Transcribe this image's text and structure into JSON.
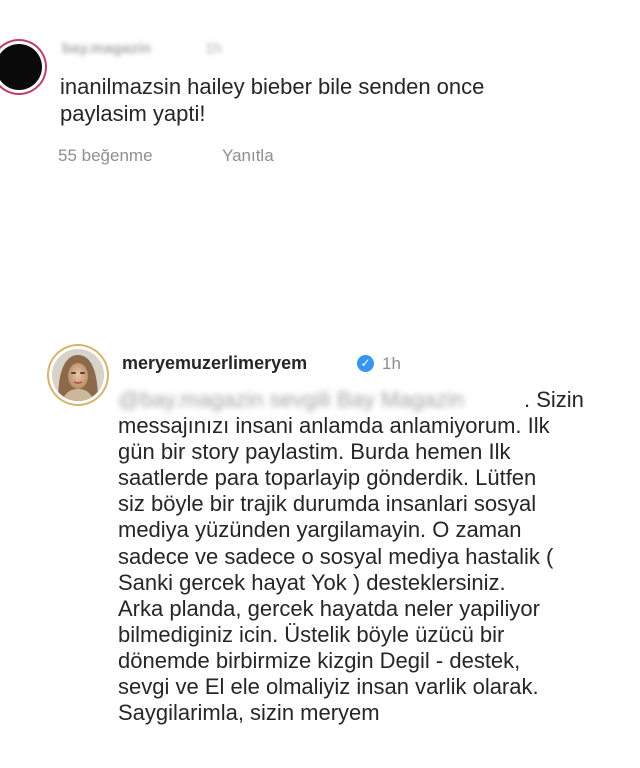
{
  "comments": [
    {
      "username": "bay.magazin",
      "time": "1h",
      "text": "inanilmazsin hailey bieber bile senden once\npaylasim yapti!",
      "likes": "55 beğenme",
      "reply": "Yanıtla"
    },
    {
      "username": "meryemuzerlimeryem",
      "verified": true,
      "time": "1h",
      "mention": "@bay.magazin sevgili Bay Magazin",
      "text_first": ". Sizin",
      "text": "messajınızı insani anlamda anlamiyorum. Ilk\ngün bir story paylastim. Burda hemen Ilk\nsaatlerde para toparlayip gönderdik. Lütfen\nsiz böyle bir trajik durumda insanlari sosyal\nmediya yüzünden yargilamayin. O zaman\nsadece ve sadece o sosyal mediya hastalik (\nSanki gercek hayat Yok ) desteklersiniz.\nArka planda, gercek hayatda neler yapiliyor\nbilmediginiz icin. Üstelik böyle üzücü bir\ndönemde birbirmize kizgin Degil - destek,\nsevgi ve El ele olmaliyiz insan varlik olarak.\nSaygilarimla, sizin meryem"
    }
  ],
  "icons": {
    "verified": "verified-badge-icon",
    "check": "✓"
  }
}
